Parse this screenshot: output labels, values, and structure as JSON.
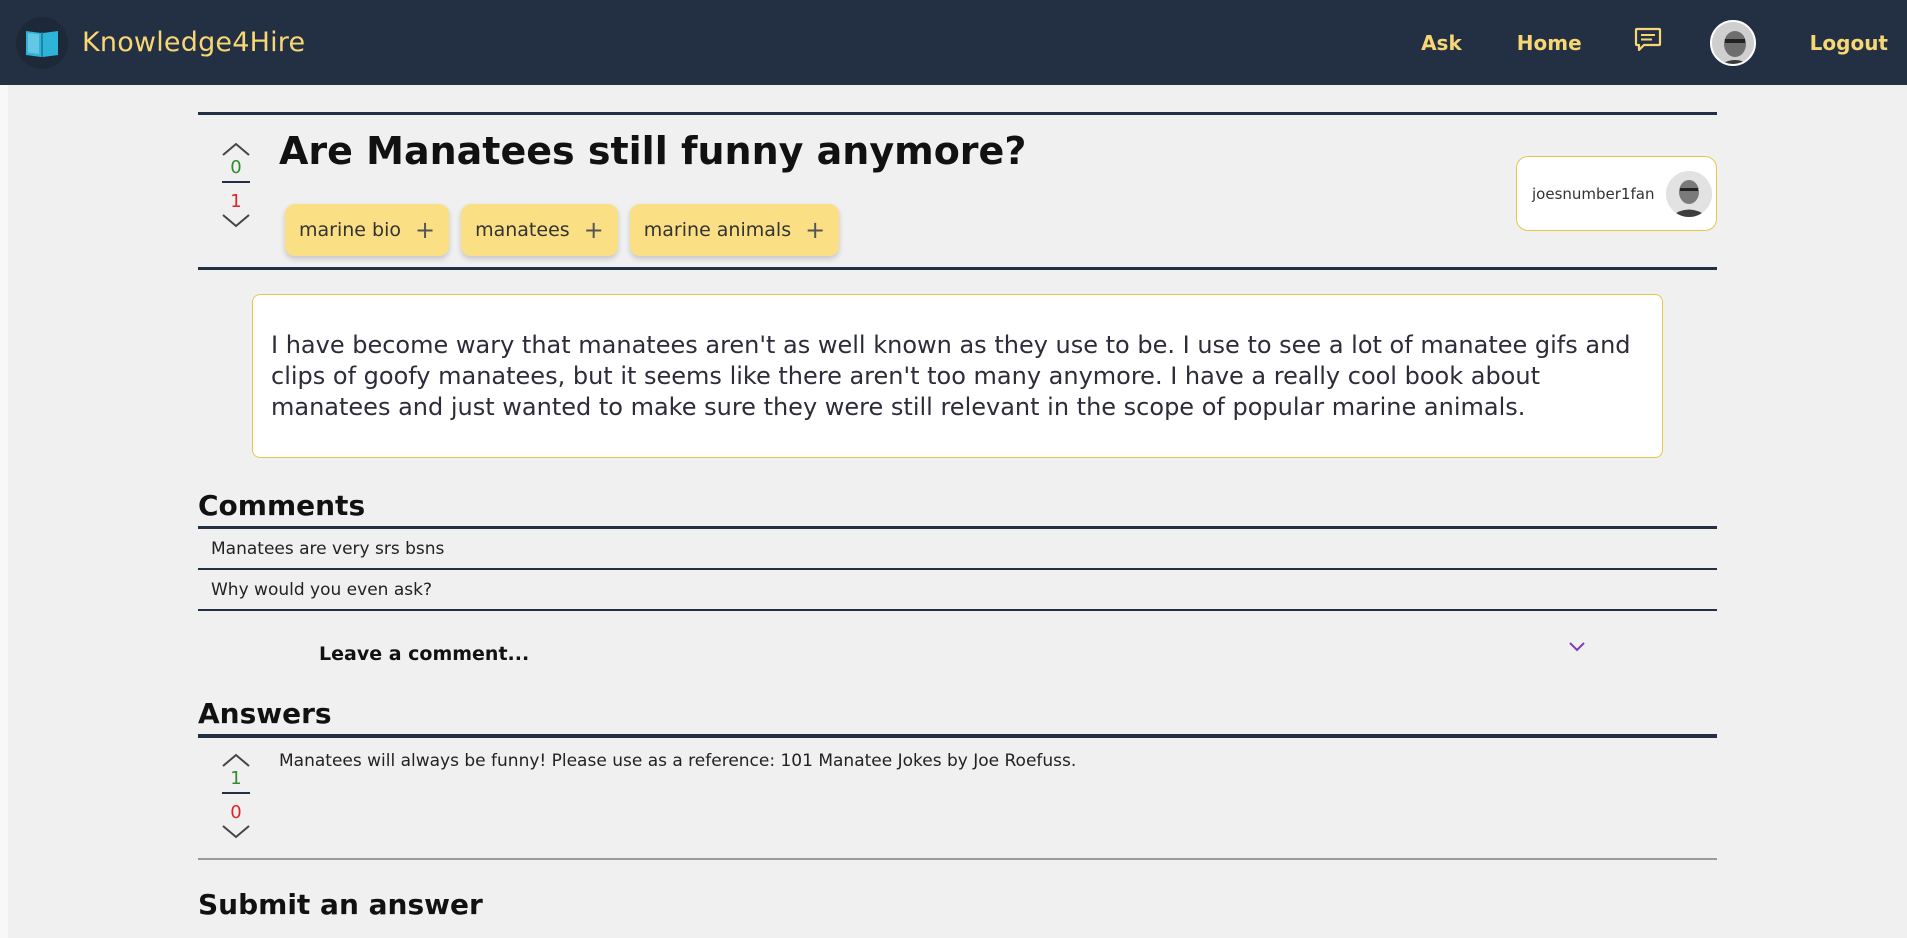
{
  "nav": {
    "brand": "Knowledge4Hire",
    "ask": "Ask",
    "home": "Home",
    "logout": "Logout",
    "brand_color": "#f7d774",
    "bar_color": "#232f43"
  },
  "question": {
    "title": "Are Manatees still funny anymore?",
    "upvotes": "0",
    "downvotes": "1",
    "tags": [
      "marine bio",
      "manatees",
      "marine animals"
    ],
    "author": "joesnumber1fan",
    "body": "I have become wary that manatees aren't as well known as they use to be. I use to see a lot of manatee gifs and clips of goofy manatees, but it seems like there aren't too many anymore. I have a really cool book about manatees and just wanted to make sure they were still relevant in the scope of popular marine animals."
  },
  "comments": {
    "title": "Comments",
    "items": [
      "Manatees are very srs bsns",
      "Why would you even ask?"
    ],
    "leave_label": "Leave a comment..."
  },
  "answers": {
    "title": "Answers",
    "items": [
      {
        "text": "Manatees will always be funny! Please use as a reference: 101 Manatee Jokes by Joe Roefuss.",
        "upvotes": "1",
        "downvotes": "0"
      }
    ]
  },
  "submit": {
    "title": "Submit an answer"
  }
}
